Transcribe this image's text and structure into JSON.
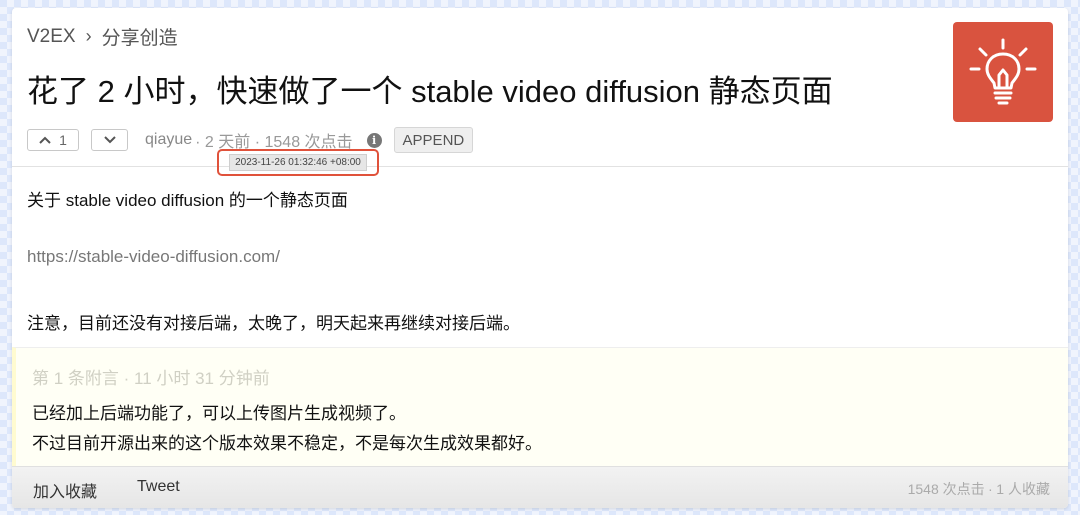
{
  "breadcrumb": {
    "site": "V2EX",
    "separator": "›",
    "node": "分享创造"
  },
  "topic": {
    "title": "花了 2 小时，快速做了一个 stable video diffusion 静态页面",
    "node_logo_icon": "lightbulb-icon",
    "node_logo_color": "#d9533f"
  },
  "meta": {
    "upvote_count": "1",
    "author": "qiayue",
    "info": " · 2 天前 · 1548 次点击",
    "append_label": "APPEND",
    "tooltip_time": "2023-11-26 01:32:46 +08:00",
    "tooltip_border_color": "#e0523b"
  },
  "content": {
    "line1": "关于 stable video diffusion 的一个静态页面",
    "link": "https://stable-video-diffusion.com/",
    "line3": "注意，目前还没有对接后端，太晚了，明天起来再继续对接后端。"
  },
  "supplement": {
    "header": "第 1 条附言  ·  11 小时 31 分钟前",
    "line1": "已经加上后端功能了，可以上传图片生成视频了。",
    "line2": "不过目前开源出来的这个版本效果不稳定，不是每次生成效果都好。"
  },
  "footer": {
    "favorite_label": "加入收藏",
    "tweet_label": "Tweet",
    "stats": "1548 次点击 ∙ 1 人收藏"
  }
}
